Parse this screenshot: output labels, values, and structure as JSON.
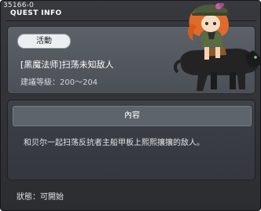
{
  "header": {
    "quest_code": "35166-0",
    "title": "QUEST INFO"
  },
  "quest": {
    "category_badge": "活動",
    "name": "[黑魔法师]扫荡未知敌人",
    "level_requirement": "建議等級：200～204"
  },
  "content": {
    "header_label": "內容",
    "description": "和贝尔一起扫荡反抗者主船甲板上熙熙攘攘的敌人。"
  },
  "status": {
    "text": "狀態：可開始"
  },
  "colors": {
    "window_bg": "#333539",
    "panel_top_bg": "#565a61",
    "content_header_bg": "#5e646c",
    "badge_bg": "#eceff2",
    "hair": "#e06a2a",
    "hat": "#4d5a3a",
    "panther": "#232323"
  },
  "icons": [
    "npc-character-image"
  ]
}
